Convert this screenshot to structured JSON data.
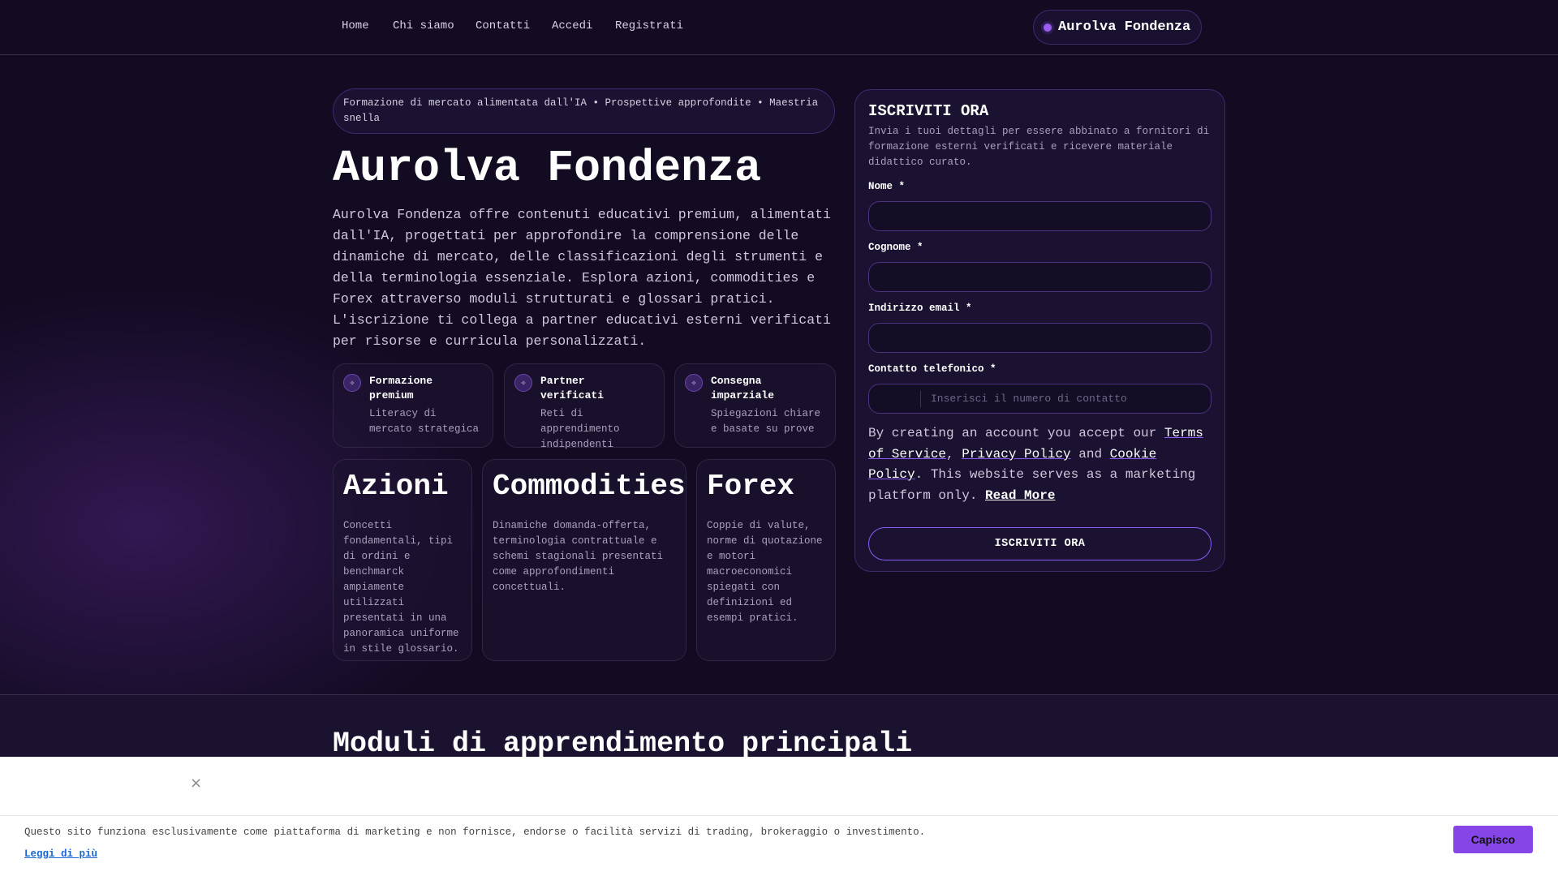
{
  "nav": {
    "links": [
      "Home",
      "Chi siamo",
      "Contatti",
      "Accedi",
      "Registrati"
    ],
    "brand": "Aurolva Fondenza"
  },
  "hero": {
    "tagline": "Formazione di mercato alimentata dall'IA • Prospettive approfondite • Maestria snella",
    "title": "Aurolva Fondenza",
    "lead": "Aurolva Fondenza offre contenuti educativi premium, alimentati dall'IA, progettati per approfondire la comprensione delle dinamiche di mercato, delle classificazioni degli strumenti e della terminologia essenziale. Esplora azioni, commodities e Forex attraverso moduli strutturati e glossari pratici. L'iscrizione ti collega a partner educativi esterni verificati per risorse e curricula personalizzati."
  },
  "features": [
    {
      "title": "Formazione premium",
      "desc": "Literacy di mercato strategica"
    },
    {
      "title": "Partner verificati",
      "desc": "Reti di apprendimento indipendenti"
    },
    {
      "title": "Consegna imparziale",
      "desc": "Spiegazioni chiare e basate su prove"
    }
  ],
  "markets": [
    {
      "title": "Azioni",
      "desc": "Concetti fondamentali, tipi di ordini e benchmarck ampiamente utilizzati presentati in una panoramica uniforme in stile glossario."
    },
    {
      "title": "Commodities",
      "desc": "Dinamiche domanda-offerta, terminologia contrattuale e schemi stagionali presentati come approfondimenti concettuali."
    },
    {
      "title": "Forex",
      "desc": "Coppie di valute, norme di quotazione e motori macroeconomici spiegati con definizioni ed esempi pratici."
    }
  ],
  "form": {
    "title": "ISCRIVITI ORA",
    "desc": "Invia i tuoi dettagli per essere abbinato a fornitori di formazione esterni verificati e ricevere materiale didattico curato.",
    "first_name_label": "Nome *",
    "last_name_label": "Cognome *",
    "email_label": "Indirizzo email *",
    "phone_label": "Contatto telefonico *",
    "phone_placeholder": "Inserisci il numero di contatto",
    "legal": {
      "p1": "By creating an account you accept our ",
      "terms": "Terms of Service",
      "sep1": ", ",
      "privacy": "Privacy Policy",
      "sep2": " and ",
      "cookie": "Cookie Policy",
      "p2": ". This website serves as a marketing platform only. ",
      "read_more": "Read More"
    },
    "submit": "ISCRIVITI ORA"
  },
  "modules": {
    "title": "Moduli di apprendimento principali"
  },
  "cookie": {
    "close": "×",
    "message": "Questo sito funziona esclusivamente come piattaforma di marketing e non fornisce, endorse o facilità servizi di trading, brokeraggio o investimento.",
    "link": "Leggi di più",
    "accept": "Capisco"
  }
}
